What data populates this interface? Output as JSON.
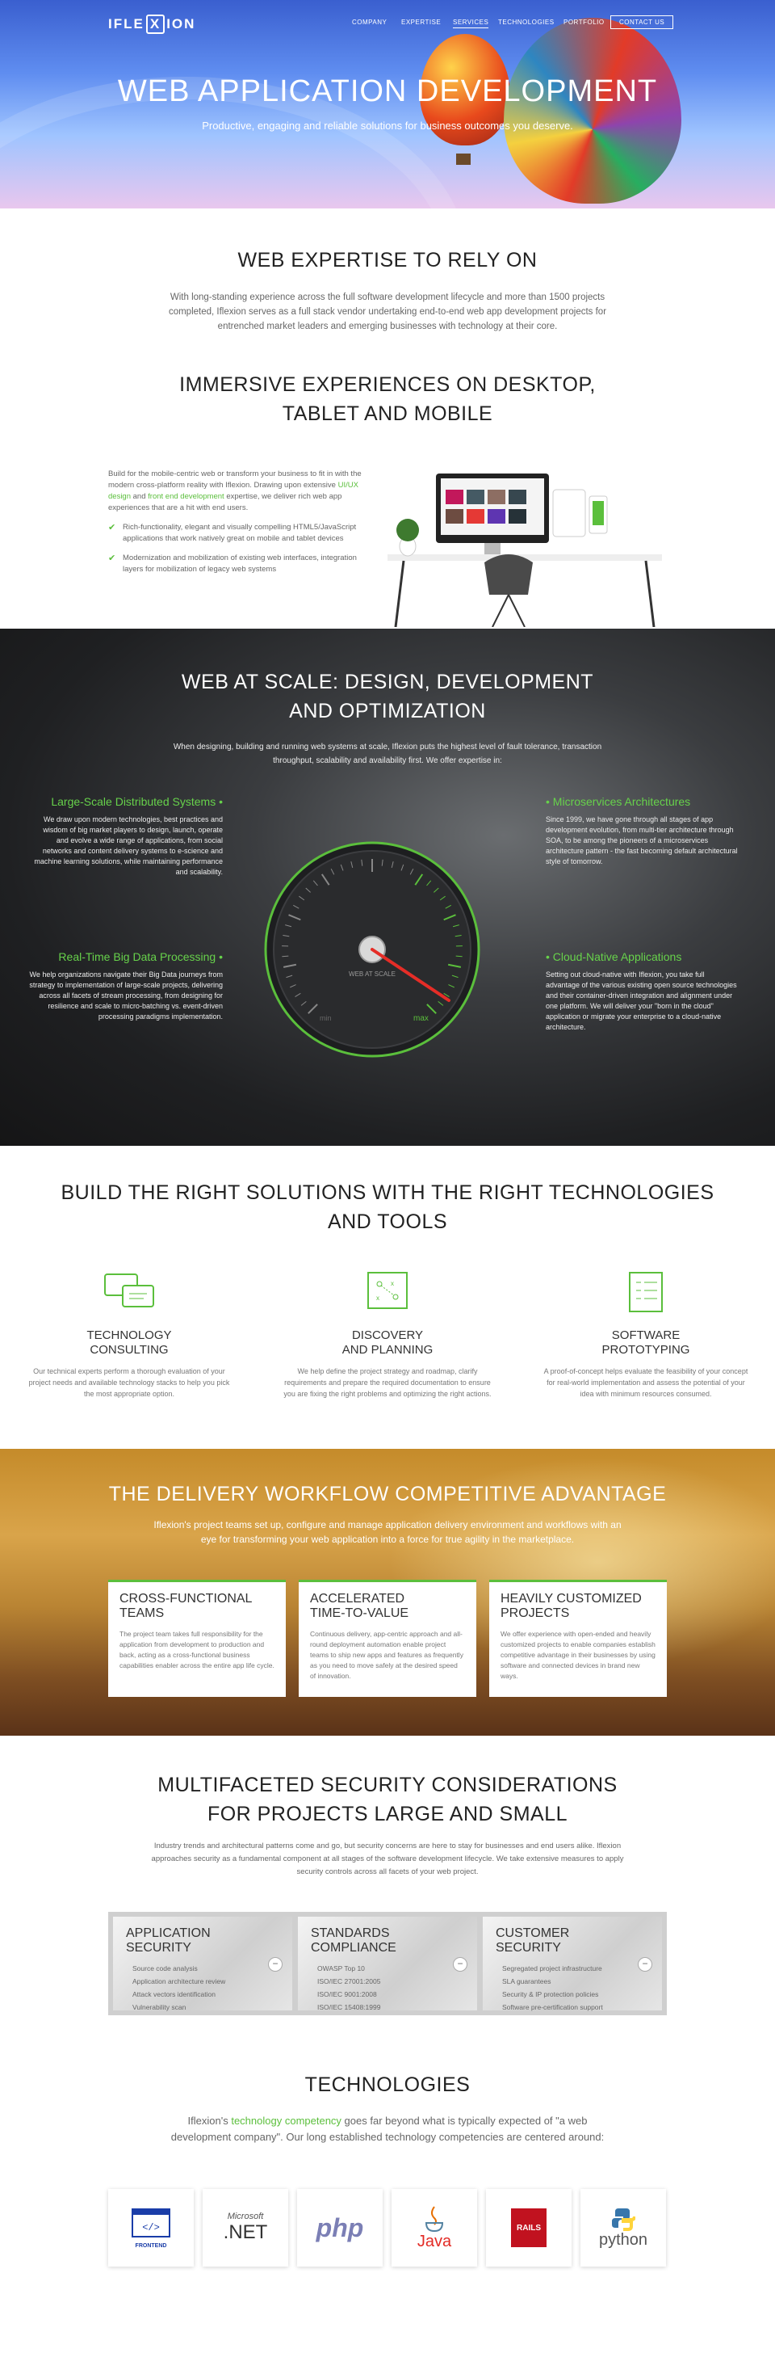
{
  "nav": {
    "logo_left": "IFLE",
    "logo_x": "X",
    "logo_right": "ION",
    "items": [
      "COMPANY",
      "EXPERTISE",
      "SERVICES",
      "TECHNOLOGIES",
      "PORTFOLIO"
    ],
    "contact": "CONTACT US"
  },
  "hero": {
    "title": "WEB APPLICATION DEVELOPMENT",
    "subtitle": "Productive, engaging and reliable solutions for business outcomes you deserve."
  },
  "expertise": {
    "title": "WEB EXPERTISE TO RELY ON",
    "text": "With long-standing experience across the full software development lifecycle and more than 1500 projects completed, Iflexion serves as a full stack vendor undertaking end-to-end web app development projects for entrenched market leaders and emerging businesses with technology at their core."
  },
  "immersive": {
    "title_line1": "IMMERSIVE EXPERIENCES ON DESKTOP,",
    "title_line2": "TABLET AND MOBILE",
    "intro_a": "Build for the mobile-centric web or transform your business to fit in with the modern cross-platform reality with Iflexion. Drawing upon extensive ",
    "link1": "UI/UX design",
    "intro_b": " and ",
    "link2": "front end development",
    "intro_c": " expertise, we deliver rich web app experiences that are a hit with end users.",
    "bullet1": "Rich-functionality, elegant and visually compelling HTML5/JavaScript applications that work natively great on mobile and tablet devices",
    "bullet2": "Modernization and mobilization of existing web interfaces, integration layers for mobilization of legacy web systems"
  },
  "scale": {
    "title_line1": "WEB AT SCALE: DESIGN, DEVELOPMENT",
    "title_line2": "AND OPTIMIZATION",
    "intro": "When designing, building and running web systems at scale, Iflexion puts the highest level of fault tolerance, transaction throughput, scalability and availability first. We offer expertise in:",
    "features": [
      {
        "title": "Large-Scale Distributed Systems",
        "text": "We draw upon modern technologies, best practices and wisdom of big market players to design, launch, operate and evolve a wide range of applications, from social networks and content delivery systems to e-science and machine learning solutions, while maintaining performance and scalability."
      },
      {
        "title": "Microservices Architectures",
        "text": "Since 1999, we have gone through all stages of app development evolution, from multi-tier architecture through SOA, to be among the pioneers of a microservices architecture pattern - the fast becoming default architectural style of tomorrow."
      },
      {
        "title": "Real-Time Big Data Processing",
        "text": "We help organizations navigate their Big Data journeys from strategy to implementation of large-scale projects, delivering across all facets of stream processing, from designing for resilience and scale to micro-batching vs. event-driven processing paradigms implementation."
      },
      {
        "title": "Cloud-Native Applications",
        "text": "Setting out cloud-native with Iflexion, you take full advantage of the various existing open source technologies and their container-driven integration and alignment under one platform. We will deliver your \"born in the cloud\" application or migrate your enterprise to a cloud-native architecture."
      }
    ],
    "gauge_label": "WEB AT SCALE",
    "gauge_min": "min",
    "gauge_max": "max"
  },
  "solutions": {
    "title_line1": "BUILD THE RIGHT SOLUTIONS WITH THE RIGHT TECHNOLOGIES",
    "title_line2": "AND TOOLS",
    "items": [
      {
        "title_line1": "TECHNOLOGY",
        "title_line2": "CONSULTING",
        "text": "Our technical experts perform a thorough evaluation of your project needs and available technology stacks to help you pick the most appropriate option."
      },
      {
        "title_line1": "DISCOVERY",
        "title_line2": "AND PLANNING",
        "text": "We help define the project strategy and roadmap, clarify requirements and prepare the required documentation to ensure you are fixing the right problems and optimizing the right actions."
      },
      {
        "title_line1": "SOFTWARE",
        "title_line2": "PROTOTYPING",
        "text": "A proof-of-concept helps evaluate the feasibility of your concept for real-world implementation and assess the potential of your idea with minimum resources consumed."
      }
    ]
  },
  "workflow": {
    "title": "THE DELIVERY WORKFLOW COMPETITIVE ADVANTAGE",
    "intro": "Iflexion's project teams set up, configure and manage application delivery environment and workflows with an eye for transforming your web application into a force for true agility in the marketplace.",
    "cards": [
      {
        "title_line1": "CROSS-FUNCTIONAL",
        "title_line2": "TEAMS",
        "text": "The project team takes full responsibility for the application from development to production and back, acting as a cross-functional business capabilities enabler across the entire app life cycle."
      },
      {
        "title_line1": "ACCELERATED",
        "title_line2": "TIME-TO-VALUE",
        "text": "Continuous delivery, app-centric approach and all-round deployment automation enable project teams to ship new apps and features as frequently as you need to move safely at the desired speed of innovation."
      },
      {
        "title_line1": "HEAVILY CUSTOMIZED",
        "title_line2": "PROJECTS",
        "text": "We offer experience with open-ended and heavily customized projects to enable companies establish competitive advantage in their businesses by using software and connected devices in brand new ways."
      }
    ]
  },
  "security": {
    "title_line1": "MULTIFACETED SECURITY CONSIDERATIONS",
    "title_line2": "FOR PROJECTS LARGE AND SMALL",
    "intro": "Industry trends and architectural patterns come and go, but security concerns are here to stay for businesses and end users alike. Iflexion approaches security as a fundamental component at all stages of the software development lifecycle. We take extensive measures to apply security controls across all facets of your web project.",
    "columns": [
      {
        "title_line1": "APPLICATION",
        "title_line2": "SECURITY",
        "items": [
          "Source code analysis",
          "Application architecture review",
          "Attack vectors identification",
          "Vulnerability scan"
        ]
      },
      {
        "title_line1": "STANDARDS",
        "title_line2": "COMPLIANCE",
        "items": [
          "OWASP Top 10",
          "ISO/IEC 27001:2005",
          "ISO/IEC 9001:2008",
          "ISO/IEC 15408:1999"
        ]
      },
      {
        "title_line1": "CUSTOMER",
        "title_line2": "SECURITY",
        "items": [
          "Segregated project infrastructure",
          "SLA guarantees",
          "Security & IP protection policies",
          "Software pre-certification support"
        ]
      }
    ],
    "toggle": "−"
  },
  "technologies": {
    "title": "TECHNOLOGIES",
    "intro_a": "Iflexion's ",
    "link": "technology competency",
    "intro_b": " goes far beyond what is typically expected of \"a web development company\". Our long established technology competencies are centered around:",
    "logos": {
      "frontend": "FRONTEND",
      "dotnet_top": "Microsoft",
      "dotnet_bottom": ".NET",
      "php": "php",
      "java": "Java",
      "rails": "RAILS",
      "python": "python"
    }
  },
  "colors": {
    "accent": "#5bbf3c",
    "dark": "#1f2022"
  }
}
